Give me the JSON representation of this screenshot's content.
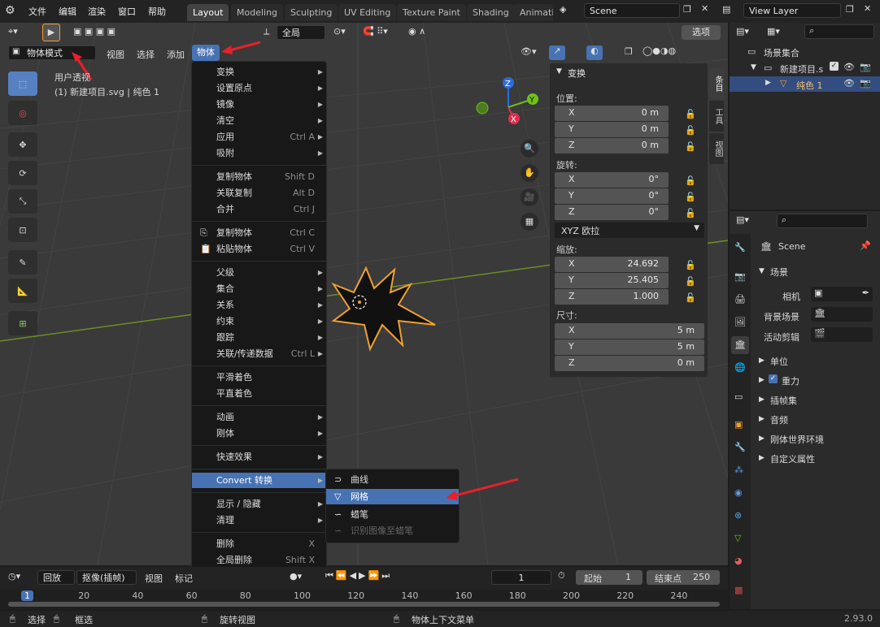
{
  "topbar": {
    "menus": [
      "文件",
      "编辑",
      "渲染",
      "窗口",
      "帮助"
    ],
    "workspace_tabs": [
      "Layout",
      "Modeling",
      "Sculpting",
      "UV Editing",
      "Texture Paint",
      "Shading",
      "Animati"
    ],
    "scene_name": "Scene",
    "view_layer": "View Layer"
  },
  "viewport": {
    "mode": "物体模式",
    "header_menus": [
      "视图",
      "选择",
      "添加",
      "物体"
    ],
    "transform_orientation": "全局",
    "options_label": "选项",
    "info_line1": "用户透视",
    "info_line2": "(1) 新建项目.svg | 纯色 1"
  },
  "object_menu": {
    "items": [
      {
        "label": "变换",
        "shortcut": "",
        "submenu": true
      },
      {
        "label": "设置原点",
        "shortcut": "",
        "submenu": true
      },
      {
        "label": "镜像",
        "shortcut": "",
        "submenu": true
      },
      {
        "label": "清空",
        "shortcut": "",
        "submenu": true
      },
      {
        "label": "应用",
        "shortcut": "Ctrl A",
        "submenu": true
      },
      {
        "label": "吸附",
        "shortcut": "",
        "submenu": true
      },
      {
        "label": "复制物体",
        "shortcut": "Shift D",
        "submenu": false
      },
      {
        "label": "关联复制",
        "shortcut": "Alt D",
        "submenu": false
      },
      {
        "label": "合并",
        "shortcut": "Ctrl J",
        "submenu": false
      },
      {
        "label": "复制物体",
        "shortcut": "Ctrl C",
        "submenu": false
      },
      {
        "label": "粘贴物体",
        "shortcut": "Ctrl V",
        "submenu": false
      },
      {
        "label": "父级",
        "shortcut": "",
        "submenu": true
      },
      {
        "label": "集合",
        "shortcut": "",
        "submenu": true
      },
      {
        "label": "关系",
        "shortcut": "",
        "submenu": true
      },
      {
        "label": "约束",
        "shortcut": "",
        "submenu": true
      },
      {
        "label": "跟踪",
        "shortcut": "",
        "submenu": true
      },
      {
        "label": "关联/传递数据",
        "shortcut": "Ctrl L",
        "submenu": true
      },
      {
        "label": "平滑着色",
        "shortcut": "",
        "submenu": false
      },
      {
        "label": "平直着色",
        "shortcut": "",
        "submenu": false
      },
      {
        "label": "动画",
        "shortcut": "",
        "submenu": true
      },
      {
        "label": "刚体",
        "shortcut": "",
        "submenu": true
      },
      {
        "label": "快速效果",
        "shortcut": "",
        "submenu": true
      },
      {
        "label": "Convert 转换",
        "shortcut": "",
        "submenu": true
      },
      {
        "label": "显示 / 隐藏",
        "shortcut": "",
        "submenu": true
      },
      {
        "label": "清理",
        "shortcut": "",
        "submenu": true
      },
      {
        "label": "删除",
        "shortcut": "X",
        "submenu": false
      },
      {
        "label": "全局删除",
        "shortcut": "Shift X",
        "submenu": false
      }
    ]
  },
  "convert_menu": {
    "items": [
      {
        "label": "曲线",
        "icon": "curve-icon"
      },
      {
        "label": "网格",
        "icon": "mesh-icon"
      },
      {
        "label": "蜡笔",
        "icon": "grease-pencil-icon"
      },
      {
        "label": "识别图像至蜡笔",
        "icon": "grease-pencil-icon"
      }
    ]
  },
  "npanel": {
    "title": "变换",
    "location_label": "位置:",
    "location": [
      {
        "axis": "X",
        "value": "0 m"
      },
      {
        "axis": "Y",
        "value": "0 m"
      },
      {
        "axis": "Z",
        "value": "0 m"
      }
    ],
    "rotation_label": "旋转:",
    "rotation": [
      {
        "axis": "X",
        "value": "0°"
      },
      {
        "axis": "Y",
        "value": "0°"
      },
      {
        "axis": "Z",
        "value": "0°"
      }
    ],
    "rotation_mode": "XYZ 欧拉",
    "scale_label": "缩放:",
    "scale": [
      {
        "axis": "X",
        "value": "24.692"
      },
      {
        "axis": "Y",
        "value": "25.405"
      },
      {
        "axis": "Z",
        "value": "1.000"
      }
    ],
    "dimensions_label": "尺寸:",
    "dimensions": [
      {
        "axis": "X",
        "value": "5 m"
      },
      {
        "axis": "Y",
        "value": "5 m"
      },
      {
        "axis": "Z",
        "value": "0 m"
      }
    ],
    "side_tabs": [
      "条目",
      "工具",
      "视图"
    ]
  },
  "outliner": {
    "root": "场景集合",
    "collection": "新建项目.s",
    "object": "纯色 1"
  },
  "properties": {
    "scene_name": "Scene",
    "section": "场景",
    "camera_label": "相机",
    "background_label": "背景场景",
    "clip_label": "活动剪辑",
    "panels": [
      "单位",
      "重力",
      "插帧集",
      "音频",
      "刚体世界环境",
      "自定义属性"
    ]
  },
  "timeline": {
    "playback": "回放",
    "keying": "抠像(插帧)",
    "view": "视图",
    "marker": "标记",
    "current_frame": "1",
    "start_label": "起始",
    "start": "1",
    "end_label": "结束点",
    "end": "250",
    "ruler": [
      "1",
      "20",
      "40",
      "60",
      "80",
      "100",
      "120",
      "140",
      "160",
      "180",
      "200",
      "220",
      "240"
    ]
  },
  "statusbar": {
    "select": "选择",
    "box_select": "框选",
    "rotate": "旋转视图",
    "context_menu": "物体上下文菜单",
    "version": "2.93.0"
  },
  "colors": {
    "accent": "#4772b3",
    "annotation_arrow": "#e8202a",
    "selection_outline": "#f0a030"
  }
}
